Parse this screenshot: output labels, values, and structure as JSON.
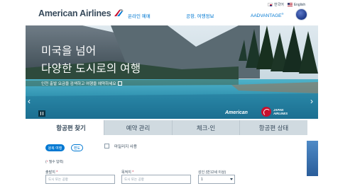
{
  "header": {
    "logo_text": "American Airlines",
    "lang_korean": "한국어",
    "lang_english": "English",
    "nav": {
      "book": "온라인 예매",
      "travel_info": "공항, 여행정보",
      "aadvantage": "AADVANTAGE",
      "aadvantage_mark": "®"
    },
    "icons": [
      "flag-kr-icon",
      "flag-us-icon",
      "aa-eagle-icon",
      "avatar-icon"
    ]
  },
  "hero": {
    "title_line1": "미국을 넘어",
    "title_line2": "다양한 도시로의 여행",
    "subtitle": "인천 출발 요금을 검색하고 여행을 예약하세요",
    "partner_aa": "American",
    "partner_jal_line1": "JAPAN",
    "partner_jal_line2": "AIRLINES",
    "prev_arrow": "‹",
    "next_arrow": "›"
  },
  "tabs": [
    {
      "label": "항공편 찾기",
      "active": true
    },
    {
      "label": "예약 관리",
      "active": false
    },
    {
      "label": "체크-인",
      "active": false
    },
    {
      "label": "항공편 상태",
      "active": false
    }
  ],
  "form": {
    "trip_roundtrip": "왕복 여행",
    "trip_oneway": "편도",
    "miles_checkbox_label": "마일리지 사용",
    "required_note_star": "*",
    "required_note_text": " 필수 입력)",
    "required_note_open": "(",
    "from_label": "출발지",
    "to_label": "목적지",
    "pax_label": "성인 (만12세 이상)",
    "from_placeholder": "도시 또는 공항",
    "to_placeholder": "도시 또는 공항",
    "pax_value": "1",
    "star": "*"
  },
  "colors": {
    "brand_blue": "#0078d2",
    "text_dark": "#36495a",
    "tab_inactive": "#d0dae0",
    "required_red": "#c8102e"
  }
}
